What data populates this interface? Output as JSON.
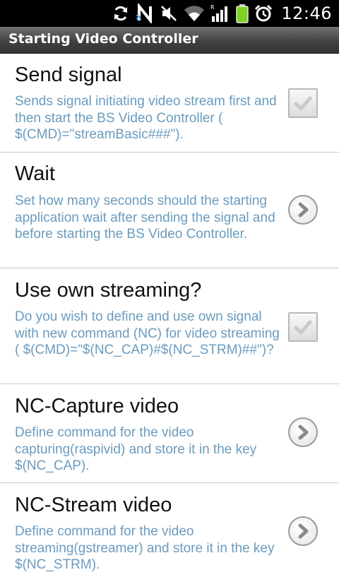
{
  "status_bar": {
    "time": "12:46",
    "icons": [
      "sync-icon",
      "nfc-icon",
      "mute-icon",
      "wifi-icon",
      "signal-icon",
      "battery-icon",
      "alarm-icon"
    ],
    "battery_color": "#7ed321",
    "roaming_label": "R"
  },
  "title_bar": {
    "title": "Starting Video Controller"
  },
  "preferences": [
    {
      "title": "Send signal",
      "summary": "Sends signal initiating video stream first and then start the BS Video Controller ( $(CMD)=\"streamBasic###\").",
      "widget": "checkbox",
      "checked": true
    },
    {
      "title": "Wait",
      "summary": "Set how many seconds should the starting application wait after sending the signal and before starting the BS Video Controller.",
      "widget": "chevron-right-icon"
    },
    {
      "title": "Use own streaming?",
      "summary": "Do you wish to define and use own signal with new command (NC) for video streaming ( $(CMD)=\"$(NC_CAP)#$(NC_STRM)##\")?",
      "widget": "checkbox",
      "checked": true
    },
    {
      "title": "NC-Capture video",
      "summary": "Define command for the video capturing(raspivid) and store it in the key $(NC_CAP).",
      "widget": "chevron-right-icon"
    },
    {
      "title": "NC-Stream video",
      "summary": "Define command for the video streaming(gstreamer) and store it in the key $(NC_STRM).",
      "widget": "chevron-right-icon"
    }
  ],
  "colors": {
    "summary_text": "#6b9bbf",
    "title_text": "#111111",
    "divider": "#c8c8c8",
    "status_bar_bg": "#000000",
    "title_bar_bg": "#3f3f3f"
  }
}
